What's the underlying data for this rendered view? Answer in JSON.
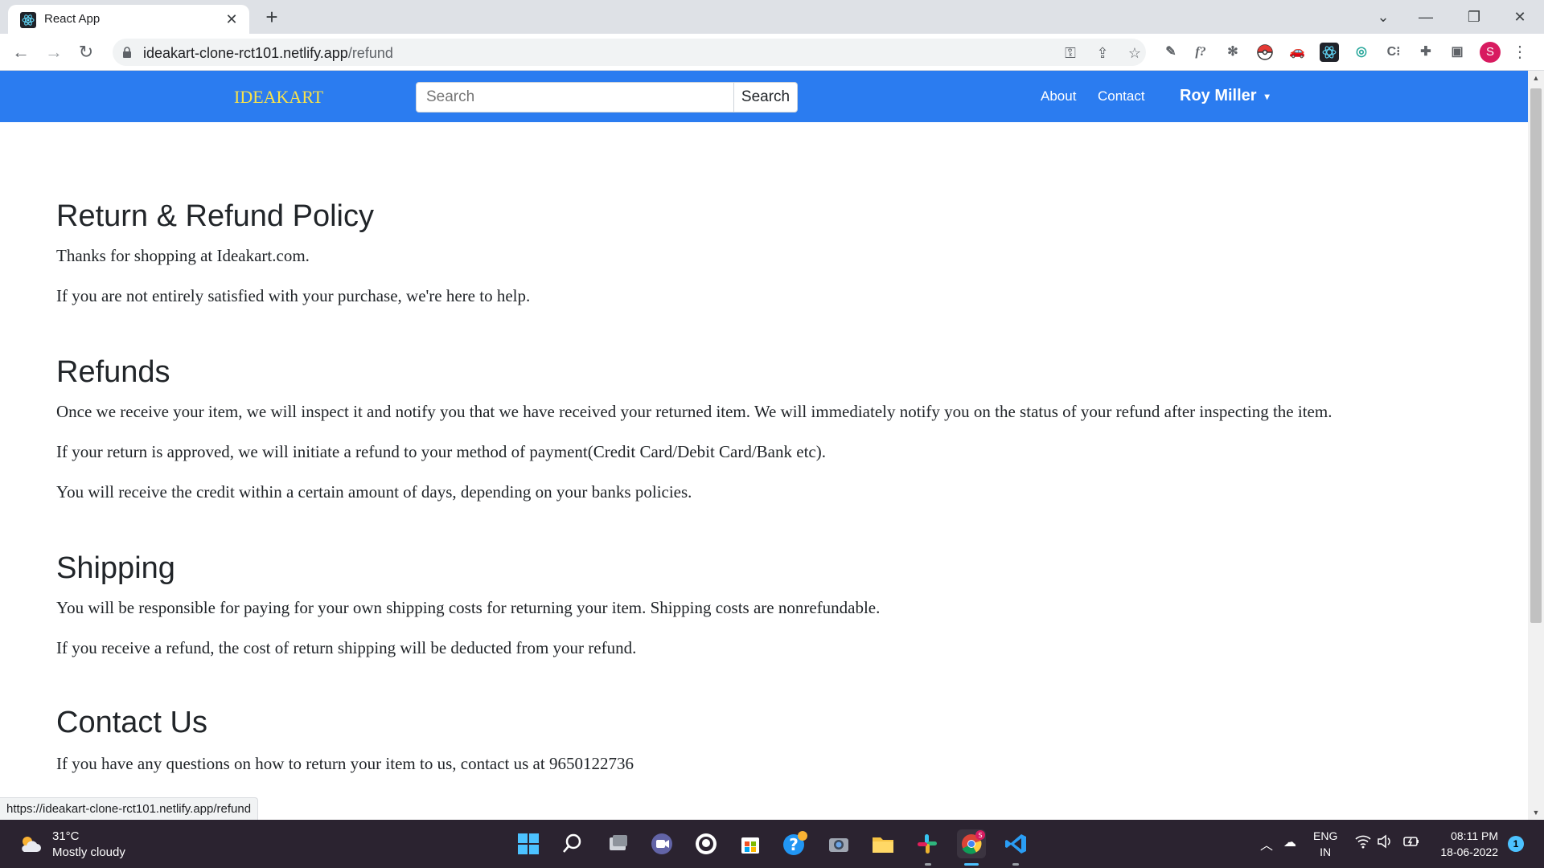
{
  "browser": {
    "tab_title": "React App",
    "url_host": "ideakart-clone-rct101.netlify.app",
    "url_path": "/refund",
    "status_url": "https://ideakart-clone-rct101.netlify.app/refund",
    "profile_initial": "S",
    "extensions": [
      "key-icon",
      "share-icon",
      "star-icon",
      "pen-extension-icon",
      "formula-extension-icon",
      "bug-extension-icon",
      "pokeball-extension-icon",
      "car-extension-icon",
      "react-devtools-icon",
      "refresh-extension-icon",
      "css-extension-icon",
      "puzzle-icon",
      "sidepanel-icon"
    ],
    "formula_ext_label": "f?",
    "css_ext_label": "C⁝"
  },
  "navbar": {
    "logo": "IDEAKART",
    "search_placeholder": "Search",
    "search_button": "Search",
    "about": "About",
    "contact": "Contact",
    "user_name": "Roy Miller"
  },
  "policy": {
    "title": "Return & Refund Policy",
    "intro": [
      "Thanks for shopping at Ideakart.com.",
      "If you are not entirely satisfied with your purchase, we're here to help."
    ],
    "refunds_heading": "Refunds",
    "refunds": [
      "Once we receive your item, we will inspect it and notify you that we have received your returned item. We will immediately notify you on the status of your refund after inspecting the item.",
      "If your return is approved, we will initiate a refund to your method of payment(Credit Card/Debit Card/Bank etc).",
      "You will receive the credit within a certain amount of days, depending on your banks policies."
    ],
    "shipping_heading": "Shipping",
    "shipping": [
      "You will be responsible for paying for your own shipping costs for returning your item. Shipping costs are nonrefundable.",
      "If you receive a refund, the cost of return shipping will be deducted from your refund."
    ],
    "contact_heading": "Contact Us",
    "contact_text": "If you have any questions on how to return your item to us, contact us at 9650122736"
  },
  "taskbar": {
    "temperature": "31°C",
    "weather": "Mostly cloudy",
    "lang_1": "ENG",
    "lang_2": "IN",
    "time": "08:11 PM",
    "date": "18-06-2022",
    "notifications": "1"
  },
  "colors": {
    "navbar": "#2b7cf0",
    "logo": "#f7e24b",
    "taskbar": "#2b2330"
  }
}
